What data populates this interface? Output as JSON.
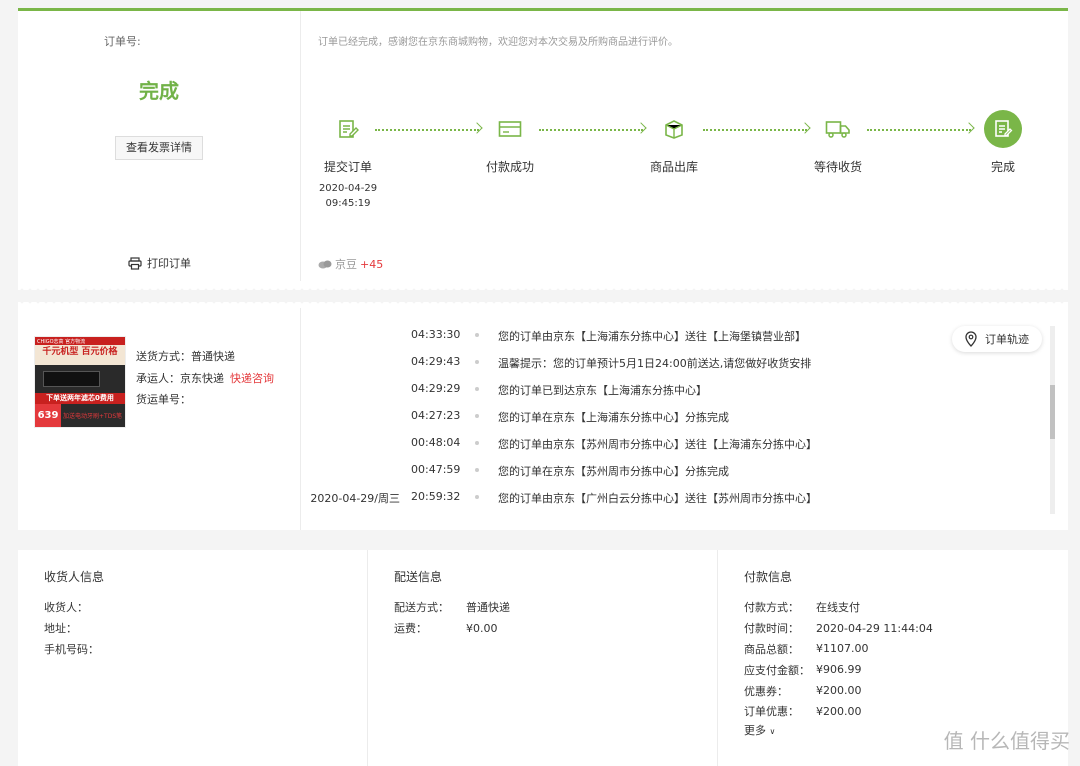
{
  "status": {
    "order_no_label": "订单号:",
    "state": "完成",
    "invoice_button": "查看发票详情",
    "print_label": "打印订单",
    "thanks_text": "订单已经完成，感谢您在京东商城购物，欢迎您对本次交易及所购商品进行评价。",
    "steps": [
      {
        "label": "提交订单",
        "date": "2020-04-29",
        "time": "09:45:19"
      },
      {
        "label": "付款成功",
        "date": "",
        "time": ""
      },
      {
        "label": "商品出库",
        "date": "",
        "time": ""
      },
      {
        "label": "等待收货",
        "date": "",
        "time": ""
      },
      {
        "label": "完成",
        "date": "",
        "time": ""
      }
    ],
    "jingdou_label": "京豆",
    "jingdou_value": "+45",
    "accent_color": "#7ab648"
  },
  "logistics": {
    "product": {
      "top_text": "CHIGO志高 官方物流",
      "headline": "千元机型 百元价格",
      "band": "下单送两年滤芯0费用",
      "price": "639",
      "gift": "加送电动牙刷+TDS笔"
    },
    "ship_method_label": "送货方式：",
    "ship_method": "普通快递",
    "carrier_label": "承运人：",
    "carrier": "京东快递",
    "consult_link": "快递咨询",
    "tracking_label": "货运单号：",
    "track_button": "订单轨迹",
    "events": [
      {
        "date": "",
        "time": "04:33:30",
        "text": "您的订单由京东【上海浦东分拣中心】送往【上海堡镇营业部】"
      },
      {
        "date": "",
        "time": "04:29:43",
        "text": "温馨提示：您的订单预计5月1日24:00前送达,请您做好收货安排"
      },
      {
        "date": "",
        "time": "04:29:29",
        "text": "您的订单已到达京东【上海浦东分拣中心】"
      },
      {
        "date": "",
        "time": "04:27:23",
        "text": "您的订单在京东【上海浦东分拣中心】分拣完成"
      },
      {
        "date": "",
        "time": "00:48:04",
        "text": "您的订单由京东【苏州周市分拣中心】送往【上海浦东分拣中心】"
      },
      {
        "date": "",
        "time": "00:47:59",
        "text": "您的订单在京东【苏州周市分拣中心】分拣完成"
      },
      {
        "date": "2020-04-29/周三",
        "time": "20:59:32",
        "text": "您的订单由京东【广州白云分拣中心】送往【苏州周市分拣中心】"
      }
    ]
  },
  "info": {
    "receiver": {
      "title": "收货人信息",
      "rows": [
        {
          "k": "收货人：",
          "v": ""
        },
        {
          "k": "地址：",
          "v": ""
        },
        {
          "k": "手机号码：",
          "v": ""
        }
      ]
    },
    "delivery": {
      "title": "配送信息",
      "rows": [
        {
          "k": "配送方式：",
          "v": "普通快递"
        },
        {
          "k": "运费：",
          "v": "¥0.00"
        }
      ]
    },
    "payment": {
      "title": "付款信息",
      "rows": [
        {
          "k": "付款方式：",
          "v": "在线支付"
        },
        {
          "k": "付款时间：",
          "v": "2020-04-29 11:44:04"
        },
        {
          "k": "商品总额：",
          "v": "¥1107.00"
        },
        {
          "k": "应支付金额：",
          "v": "¥906.99"
        },
        {
          "k": "优惠券：",
          "v": "¥200.00"
        },
        {
          "k": "订单优惠：",
          "v": "¥200.00"
        }
      ],
      "more": "更多"
    }
  },
  "watermark": "值 什么值得买"
}
